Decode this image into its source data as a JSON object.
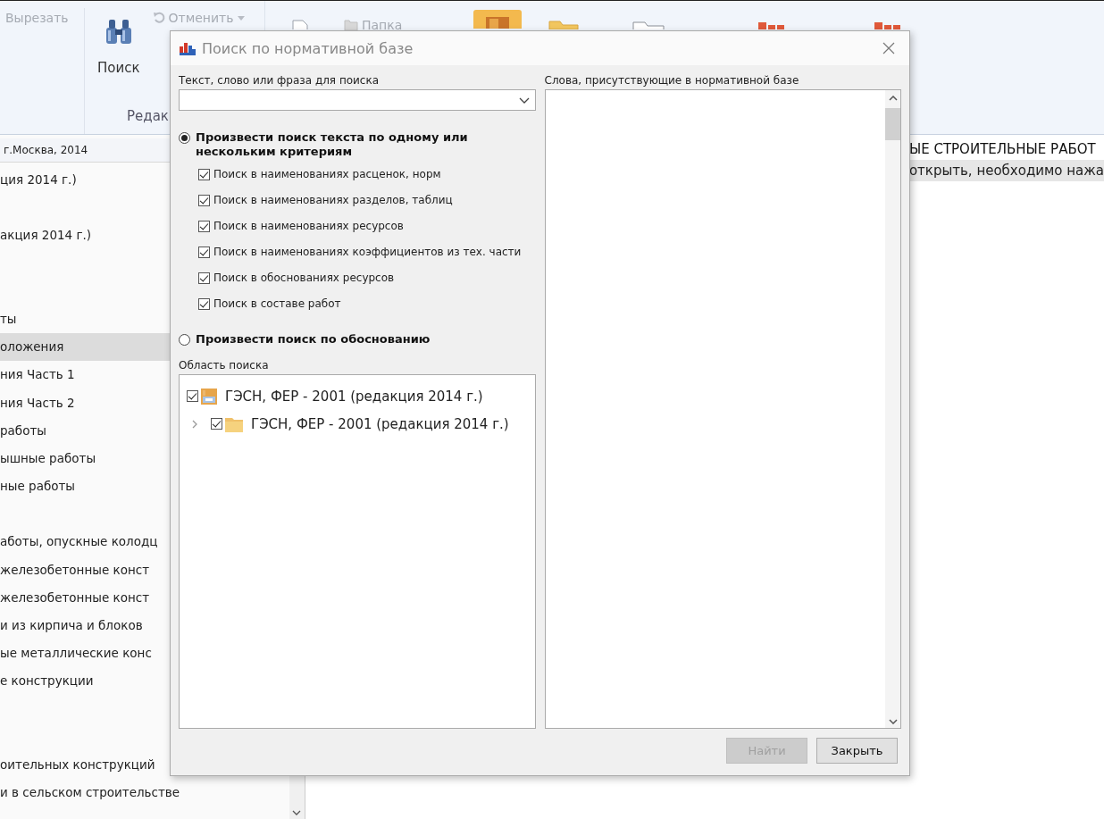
{
  "ribbon": {
    "items": [
      {
        "kind": "small",
        "label": "Вырезать",
        "disabled": true
      },
      {
        "kind": "large",
        "label": "Поиск",
        "disabled": false
      },
      {
        "kind": "undo",
        "label": "Отменить",
        "disabled": true
      },
      {
        "kind": "folder",
        "label": "Папка",
        "disabled": true
      }
    ],
    "group_label": "Редак"
  },
  "left_panel": {
    "header": "г.Москва, 2014",
    "rows": [
      {
        "kind": "row",
        "text": "ция 2014 г.)",
        "selected": false
      },
      {
        "kind": "blank"
      },
      {
        "kind": "row",
        "text": "акция 2014 г.)",
        "selected": false
      },
      {
        "kind": "blank"
      },
      {
        "kind": "blank"
      },
      {
        "kind": "row",
        "text": "ты",
        "selected": false
      },
      {
        "kind": "row",
        "text": "оложения",
        "selected": true
      },
      {
        "kind": "row",
        "text": "ния Часть 1",
        "selected": false
      },
      {
        "kind": "row",
        "text": "ния Часть 2",
        "selected": false
      },
      {
        "kind": "row",
        "text": "работы",
        "selected": false
      },
      {
        "kind": "row",
        "text": "ышные работы",
        "selected": false
      },
      {
        "kind": "row",
        "text": "ные работы",
        "selected": false
      },
      {
        "kind": "blank"
      },
      {
        "kind": "row",
        "text": "аботы, опускные колодц",
        "selected": false
      },
      {
        "kind": "row",
        "text": "железобетонные конст",
        "selected": false
      },
      {
        "kind": "row",
        "text": "железобетонные конст",
        "selected": false
      },
      {
        "kind": "row",
        "text": "и из кирпича и блоков",
        "selected": false
      },
      {
        "kind": "row",
        "text": "ые металлические конс",
        "selected": false
      },
      {
        "kind": "row",
        "text": "е конструкции",
        "selected": false
      },
      {
        "kind": "blank"
      },
      {
        "kind": "blank"
      },
      {
        "kind": "row",
        "text": "оительных конструкций",
        "selected": false
      },
      {
        "kind": "row",
        "text": "и в сельском строительстве",
        "selected": false
      }
    ]
  },
  "main": {
    "heading": "ЫЕ СТРОИТЕЛЬНЫЕ РАБОТ",
    "hint": "открыть, необходимо нажа"
  },
  "dialog": {
    "title": "Поиск по нормативной базе",
    "search_label": "Текст, слово или фраза для поиска",
    "modes": [
      {
        "label": "Произвести поиск текста по одному или нескольким критериям",
        "selected": true,
        "options": [
          {
            "label": "Поиск в наименованиях расценок, норм",
            "checked": true
          },
          {
            "label": "Поиск в наименованиях разделов, таблиц",
            "checked": true
          },
          {
            "label": "Поиск в наименованиях ресурсов",
            "checked": true
          },
          {
            "label": "Поиск в наименованиях коэффициентов из тех. части",
            "checked": true
          },
          {
            "label": "Поиск в обоснованиях ресурсов",
            "checked": true
          },
          {
            "label": "Поиск в составе работ",
            "checked": true
          }
        ]
      },
      {
        "label": "Произвести поиск по обоснованию",
        "selected": false
      }
    ],
    "scope_label": "Область поиска",
    "scope_tree": [
      {
        "label": "ГЭСН, ФЕР - 2001 (редакция 2014 г.)",
        "checked": true,
        "kind": "base",
        "children": [
          {
            "label": "ГЭСН, ФЕР - 2001 (редакция 2014 г.)",
            "checked": true,
            "kind": "folder",
            "expanded": false
          }
        ]
      }
    ],
    "words_label": "Слова, присутствующие в нормативной базе",
    "buttons": [
      {
        "label": "Найти",
        "disabled": true
      },
      {
        "label": "Закрыть",
        "disabled": false
      }
    ]
  }
}
